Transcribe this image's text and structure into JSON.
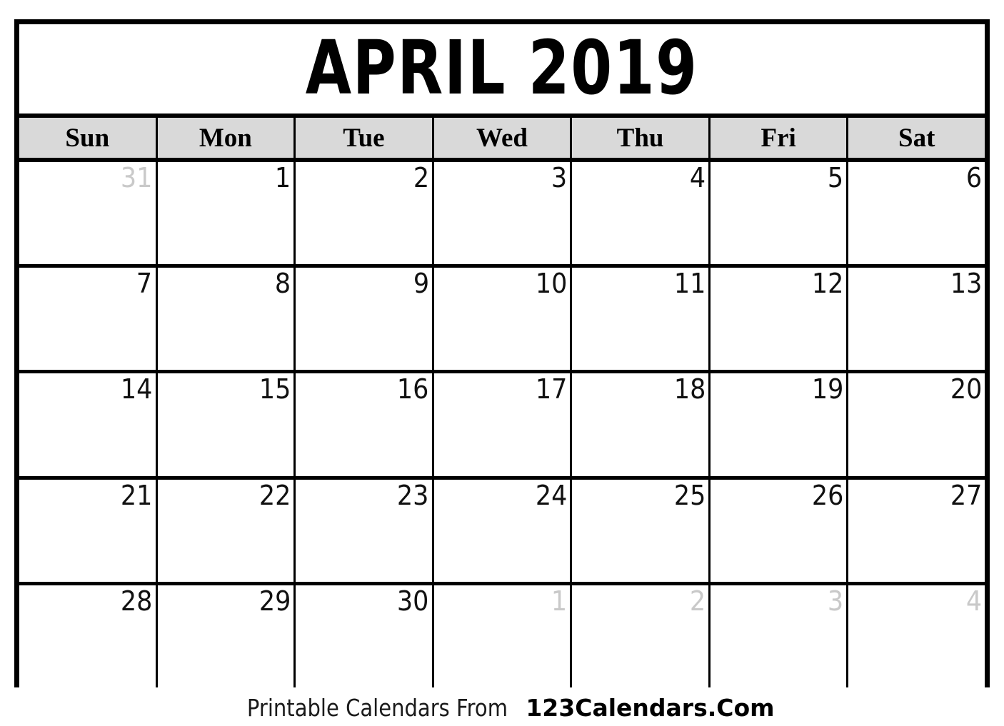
{
  "calendar": {
    "title": "APRIL 2019",
    "month": "APRIL",
    "year": "2019",
    "weekday_headers": [
      "Sun",
      "Mon",
      "Tue",
      "Wed",
      "Thu",
      "Fri",
      "Sat"
    ],
    "weeks": [
      [
        {
          "day": "31",
          "adjacent": true
        },
        {
          "day": "1",
          "adjacent": false
        },
        {
          "day": "2",
          "adjacent": false
        },
        {
          "day": "3",
          "adjacent": false
        },
        {
          "day": "4",
          "adjacent": false
        },
        {
          "day": "5",
          "adjacent": false
        },
        {
          "day": "6",
          "adjacent": false
        }
      ],
      [
        {
          "day": "7",
          "adjacent": false
        },
        {
          "day": "8",
          "adjacent": false
        },
        {
          "day": "9",
          "adjacent": false
        },
        {
          "day": "10",
          "adjacent": false
        },
        {
          "day": "11",
          "adjacent": false
        },
        {
          "day": "12",
          "adjacent": false
        },
        {
          "day": "13",
          "adjacent": false
        }
      ],
      [
        {
          "day": "14",
          "adjacent": false
        },
        {
          "day": "15",
          "adjacent": false
        },
        {
          "day": "16",
          "adjacent": false
        },
        {
          "day": "17",
          "adjacent": false
        },
        {
          "day": "18",
          "adjacent": false
        },
        {
          "day": "19",
          "adjacent": false
        },
        {
          "day": "20",
          "adjacent": false
        }
      ],
      [
        {
          "day": "21",
          "adjacent": false
        },
        {
          "day": "22",
          "adjacent": false
        },
        {
          "day": "23",
          "adjacent": false
        },
        {
          "day": "24",
          "adjacent": false
        },
        {
          "day": "25",
          "adjacent": false
        },
        {
          "day": "26",
          "adjacent": false
        },
        {
          "day": "27",
          "adjacent": false
        }
      ],
      [
        {
          "day": "28",
          "adjacent": false
        },
        {
          "day": "29",
          "adjacent": false
        },
        {
          "day": "30",
          "adjacent": false
        },
        {
          "day": "1",
          "adjacent": true
        },
        {
          "day": "2",
          "adjacent": true
        },
        {
          "day": "3",
          "adjacent": true
        },
        {
          "day": "4",
          "adjacent": true
        }
      ]
    ]
  },
  "footer": {
    "prefix": "Printable Calendars From ",
    "brand": "123Calendars.Com"
  },
  "colors": {
    "header_background": "#d9d9d9",
    "grid_line": "#000000",
    "day_text": "#111111",
    "adjacent_day_text": "#c9c9c9",
    "page_background": "#ffffff"
  }
}
